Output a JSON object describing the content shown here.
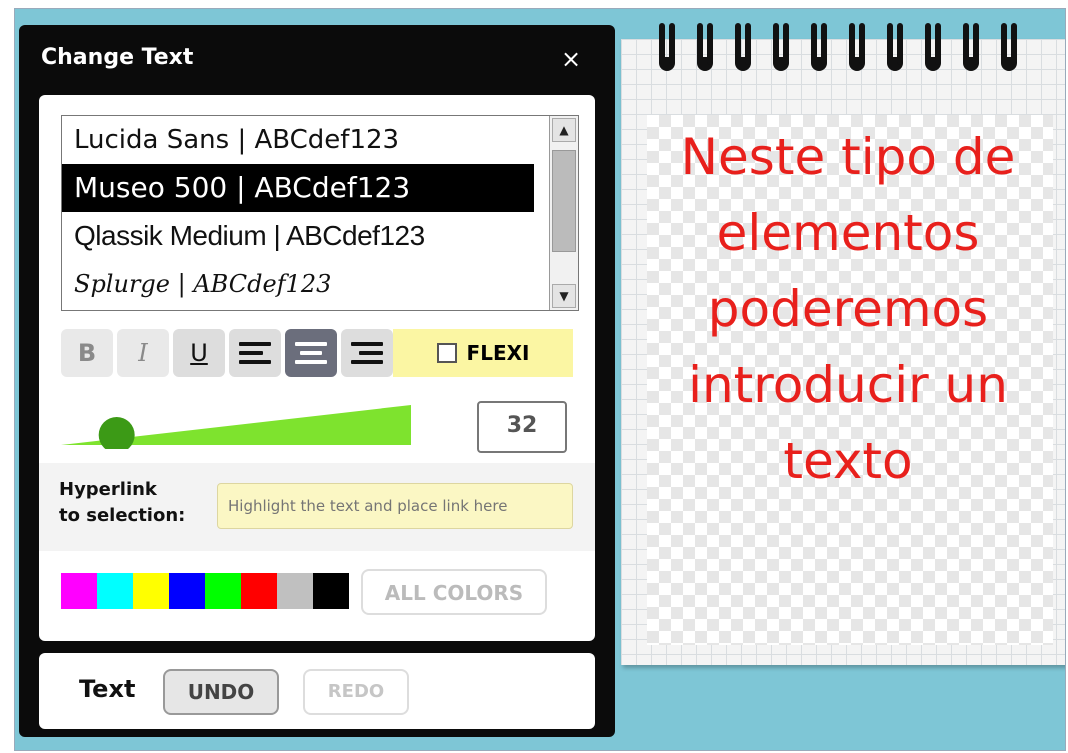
{
  "panel": {
    "title": "Change Text",
    "close_label": "×"
  },
  "font_list": {
    "items": [
      "Lucida Sans | ABCdef123",
      "Museo 500 | ABCdef123",
      "Qlassik Medium | ABCdef123",
      "Splurge | ABCdef123"
    ],
    "selected_index": 1,
    "scroll_up": "▲",
    "scroll_down": "▼"
  },
  "toolbar": {
    "bold": "B",
    "italic": "I",
    "underline": "U",
    "flexi_label": "FLEXI",
    "flexi_checked": false
  },
  "size": {
    "value": "32",
    "slider_fraction": 0.12
  },
  "hyperlink": {
    "label_line1": "Hyperlink",
    "label_line2": "to selection:",
    "placeholder": "Highlight the text and place link here"
  },
  "colors": {
    "swatches": [
      "#ff00ff",
      "#00ffff",
      "#ffff00",
      "#0000ff",
      "#00ff00",
      "#ff0000",
      "#c0c0c0",
      "#000000"
    ],
    "all_colors_label": "ALL COLORS"
  },
  "footer": {
    "label": "Text",
    "undo_label": "UNDO",
    "redo_label": "REDO"
  },
  "notepad": {
    "text": "Neste tipo de elementos poderemos introducir un texto",
    "text_color": "#e8201c"
  }
}
